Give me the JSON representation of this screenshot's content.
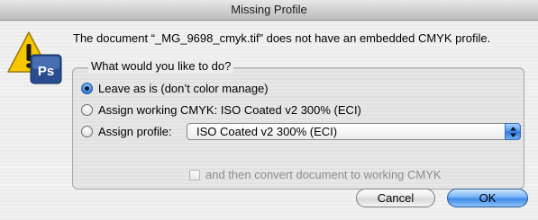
{
  "window": {
    "title": "Missing Profile"
  },
  "message": "The document “_MG_9698_cmyk.tif” does not have an embedded CMYK profile.",
  "icon": {
    "name": "warning-photoshop-icon",
    "badge_text": "Ps"
  },
  "group": {
    "title": "What would you like to do?",
    "options": [
      {
        "label": "Leave as is (don’t color manage)",
        "selected": true
      },
      {
        "label": "Assign working CMYK:  ISO Coated v2 300% (ECI)",
        "selected": false
      },
      {
        "label": "Assign profile:",
        "selected": false
      }
    ],
    "profile_select": {
      "value": "ISO Coated v2 300% (ECI)"
    },
    "convert_checkbox": {
      "label": "and then convert document to working CMYK",
      "checked": false,
      "enabled": false
    }
  },
  "buttons": {
    "cancel": "Cancel",
    "ok": "OK"
  },
  "colors": {
    "accent": "#3e8ae6",
    "warning_yellow": "#f6c700"
  }
}
